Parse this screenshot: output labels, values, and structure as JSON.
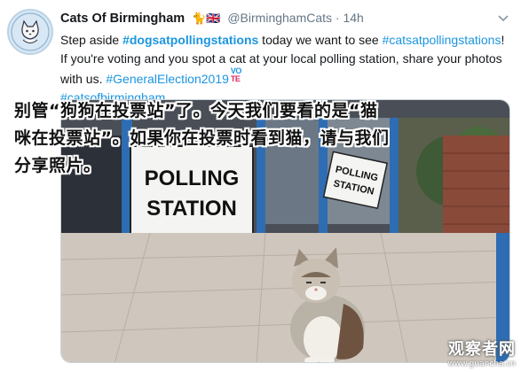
{
  "tweet": {
    "author_name": "Cats Of Birmingham",
    "name_emojis": "🐈🇬🇧",
    "handle": "@BirminghamCats",
    "separator": "·",
    "time": "14h",
    "text_parts": {
      "p1": "Step aside ",
      "hashtag1": "#dogsatpollingstations",
      "p2": " today we want to see ",
      "hashtag2": "#catsatpollingstations",
      "p3": "! If you're voting and you spot a cat at your local polling station, share your photos with us. ",
      "hashtag3": "#GeneralElection2019",
      "vote_badge_top": "VO",
      "vote_badge_bottom": "TE",
      "hashtag4": "#catsofbirmingham"
    },
    "photo": {
      "sign_large": [
        "POLLING",
        "STATION"
      ],
      "sign_small": [
        "POLLING",
        "STATION"
      ]
    }
  },
  "overlay_caption": {
    "line1": "别管“狗狗在投票站”了。今天我们要看的是“猫",
    "line2": "咪在投票站”。如果你在投票时看到猫，请与我们",
    "line3": "分享照片。"
  },
  "watermark": {
    "main": "观察者网",
    "url": "www.guancha.cn"
  },
  "colors": {
    "link": "#1b95e0",
    "meta": "#657786"
  },
  "icons": {
    "menu": "chevron-down-icon",
    "avatar": "cat-logo-icon"
  }
}
